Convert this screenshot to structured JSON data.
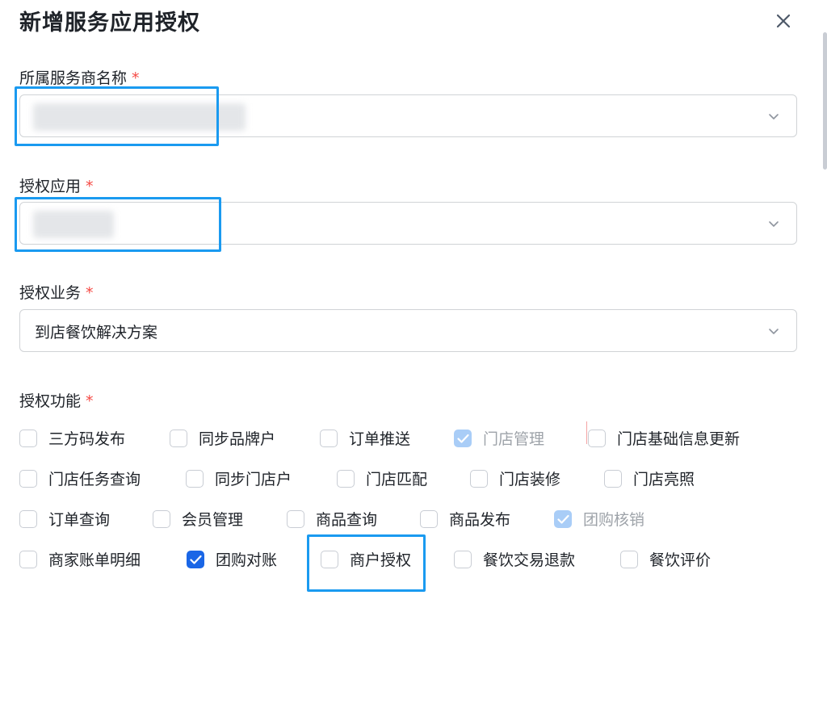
{
  "dialog": {
    "title": "新增服务应用授权"
  },
  "fields": {
    "provider": {
      "label": "所属服务商名称",
      "required_mark": "*"
    },
    "app": {
      "label": "授权应用",
      "required_mark": "*"
    },
    "business": {
      "label": "授权业务",
      "required_mark": "*",
      "value": "到店餐饮解决方案"
    },
    "functions": {
      "label": "授权功能",
      "required_mark": "*"
    }
  },
  "checkboxes": [
    {
      "label": "三方码发布",
      "checked": false,
      "disabled": false
    },
    {
      "label": "同步品牌户",
      "checked": false,
      "disabled": false
    },
    {
      "label": "订单推送",
      "checked": false,
      "disabled": false
    },
    {
      "label": "门店管理",
      "checked": true,
      "disabled": true
    },
    {
      "label": "门店基础信息更新",
      "checked": false,
      "disabled": false
    },
    {
      "label": "门店任务查询",
      "checked": false,
      "disabled": false
    },
    {
      "label": "同步门店户",
      "checked": false,
      "disabled": false
    },
    {
      "label": "门店匹配",
      "checked": false,
      "disabled": false
    },
    {
      "label": "门店装修",
      "checked": false,
      "disabled": false
    },
    {
      "label": "门店亮照",
      "checked": false,
      "disabled": false
    },
    {
      "label": "订单查询",
      "checked": false,
      "disabled": false
    },
    {
      "label": "会员管理",
      "checked": false,
      "disabled": false
    },
    {
      "label": "商品查询",
      "checked": false,
      "disabled": false
    },
    {
      "label": "商品发布",
      "checked": false,
      "disabled": false
    },
    {
      "label": "团购核销",
      "checked": true,
      "disabled": true
    },
    {
      "label": "商家账单明细",
      "checked": false,
      "disabled": false
    },
    {
      "label": "团购对账",
      "checked": true,
      "disabled": false
    },
    {
      "label": "商户授权",
      "checked": false,
      "disabled": false
    },
    {
      "label": "餐饮交易退款",
      "checked": false,
      "disabled": false
    },
    {
      "label": "餐饮评价",
      "checked": false,
      "disabled": false
    }
  ],
  "icons": {
    "close": "close-icon",
    "dropdown": "chevron-down-icon",
    "check": "check-icon"
  },
  "colors": {
    "highlight": "#1a9af0",
    "required": "#f54a45",
    "checked": "#1a66e6",
    "checked_disabled": "#a9cdf7"
  }
}
